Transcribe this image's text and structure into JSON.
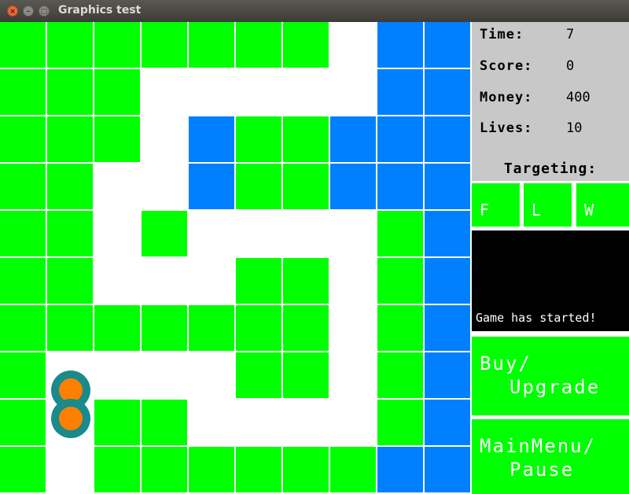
{
  "window": {
    "title": "Graphics test"
  },
  "colors": {
    "green": "#00ff00",
    "blue": "#0080ff",
    "path": "#ffffff",
    "enemy_ring": "#1a8a8a",
    "enemy_core": "#ff8000"
  },
  "board": {
    "rows": [
      "GGGGGGGWBB",
      "GGGWWWWWBB",
      "GGGWBGGBBB",
      "GGWWBGGBBB",
      "GGWGWWWWGB",
      "GGWWWGGWGB",
      "GGGGGGGWGB",
      "GWWWWGGWGB",
      "GWGGWWWWGB",
      "GWGGGGGGBB"
    ]
  },
  "enemies": [
    {
      "row": 7.8,
      "col": 1.5
    },
    {
      "row": 8.4,
      "col": 1.5
    }
  ],
  "stats": {
    "time_label": "Time:",
    "time_value": "7",
    "score_label": "Score:",
    "score_value": "0",
    "money_label": "Money:",
    "money_value": "400",
    "lives_label": "Lives:",
    "lives_value": "10"
  },
  "targeting": {
    "label": "Targeting:",
    "options": [
      "F",
      "L",
      "W"
    ]
  },
  "message": "Game has started!",
  "buttons": {
    "buy_line1": "Buy/",
    "buy_line2": "Upgrade",
    "menu_line1": "MainMenu/",
    "menu_line2": "Pause"
  }
}
